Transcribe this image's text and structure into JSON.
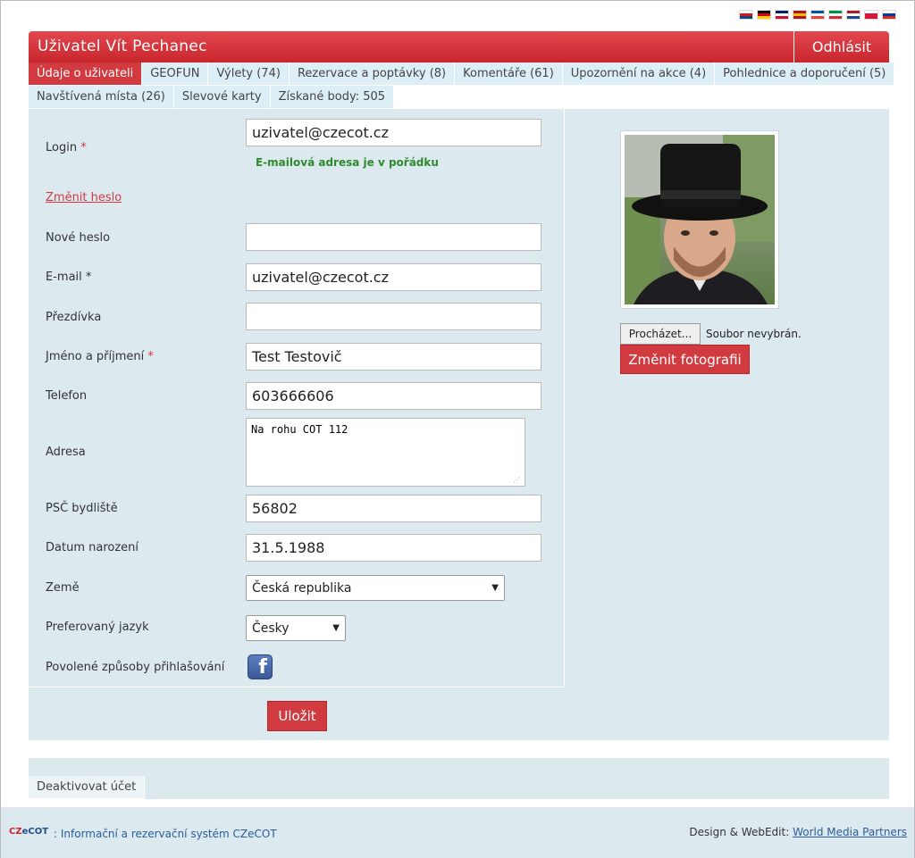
{
  "flags": [
    {
      "name": "cz-flag-icon",
      "colors": [
        "#ffffff",
        "#d7141a",
        "#11457e"
      ]
    },
    {
      "name": "de-flag-icon",
      "colors": [
        "#000000",
        "#dd0000",
        "#ffce00"
      ]
    },
    {
      "name": "gb-flag-icon",
      "colors": [
        "#012169",
        "#ffffff",
        "#c8102e"
      ]
    },
    {
      "name": "es-flag-icon",
      "colors": [
        "#aa151b",
        "#f1bf00",
        "#aa151b"
      ]
    },
    {
      "name": "fr-flag-icon",
      "colors": [
        "#0055a4",
        "#ffffff",
        "#ef4135"
      ]
    },
    {
      "name": "it-flag-icon",
      "colors": [
        "#009246",
        "#ffffff",
        "#ce2b37"
      ]
    },
    {
      "name": "nl-flag-icon",
      "colors": [
        "#ae1c28",
        "#ffffff",
        "#21468b"
      ]
    },
    {
      "name": "pl-flag-icon",
      "colors": [
        "#ffffff",
        "#dc143c",
        "#dc143c"
      ]
    },
    {
      "name": "ru-flag-icon",
      "colors": [
        "#ffffff",
        "#0039a6",
        "#d52b1e"
      ]
    }
  ],
  "header": {
    "title": "Uživatel Vít Pechanec",
    "logout_label": "Odhlásit"
  },
  "tabs_row1": [
    {
      "label": "Údaje o uživateli",
      "active": true
    },
    {
      "label": "GEOFUN"
    },
    {
      "label": "Výlety (74)"
    },
    {
      "label": "Rezervace a poptávky (8)"
    },
    {
      "label": "Komentáře (61)"
    },
    {
      "label": "Upozornění na akce (4)"
    },
    {
      "label": "Pohlednice a doporučení (5)"
    }
  ],
  "tabs_row2": [
    {
      "label": "Navštívená místa (26)"
    },
    {
      "label": "Slevové karty"
    },
    {
      "label": "Získané body: 505"
    }
  ],
  "form": {
    "login_label": "Login",
    "login_value": "uzivatel@czecot.cz",
    "login_ok_message": "E-mailová adresa je v pořádku",
    "change_password_link": "Změnit heslo",
    "new_password_label": "Nové heslo",
    "new_password_value": "",
    "email_label": "E-mail *",
    "email_value": "uzivatel@czecot.cz",
    "nickname_label": "Přezdívka",
    "nickname_value": "",
    "name_label": "Jméno a příjmení",
    "name_value": "Test Testovič",
    "phone_label": "Telefon",
    "phone_value": "603666606",
    "address_label": "Adresa",
    "address_value": "Na rohu COT 112",
    "zip_label": "PSČ bydliště",
    "zip_value": "56802",
    "birth_label": "Datum narození",
    "birth_value": "31.5.1988",
    "country_label": "Země",
    "country_value": "Česká republika",
    "language_label": "Preferovaný jazyk",
    "language_value": "Česky",
    "login_methods_label": "Povolené způsoby přihlašování",
    "required_mark": "*",
    "save_label": "Uložit"
  },
  "photo": {
    "browse_label": "Procházet...",
    "no_file_label": "Soubor nevybrán.",
    "change_photo_label": "Změnit fotografii"
  },
  "deactivate": {
    "label": "Deaktivovat účet"
  },
  "footer": {
    "logo_part1": "CZ",
    "logo_part2": "eCOT",
    "info": ": Informační a rezervační systém CZeCOT",
    "credit_label": "Design & WebEdit:",
    "credit_link": "World Media Partners"
  }
}
